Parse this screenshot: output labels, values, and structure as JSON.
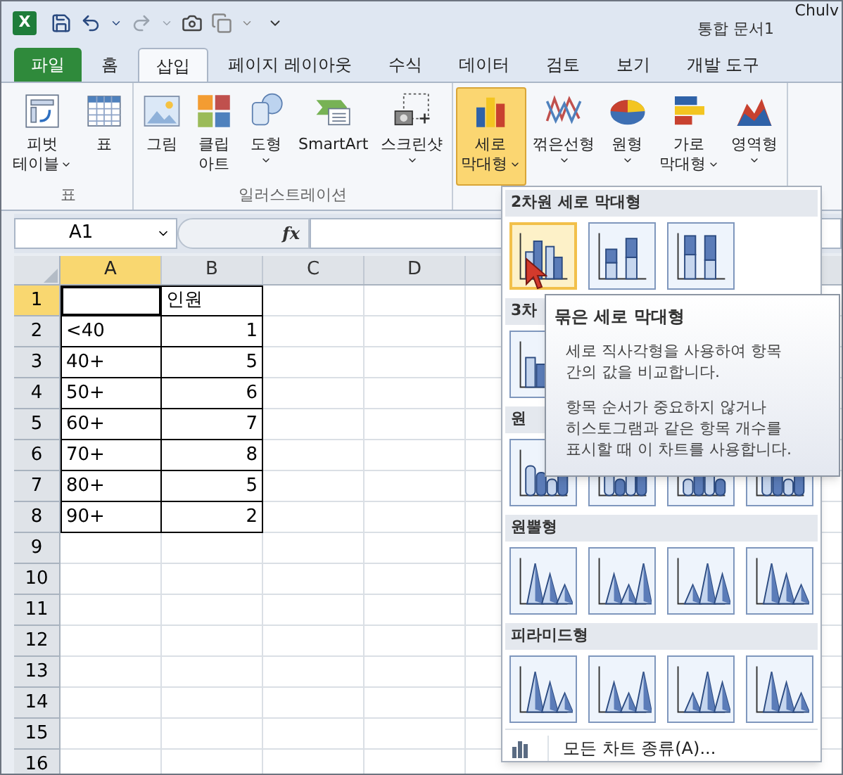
{
  "title_bar": {
    "logo": "X",
    "title": "통합 문서1",
    "overlay_text": "Chulv"
  },
  "ribbon_tabs": [
    {
      "label": "파일",
      "kind": "file",
      "selected": false
    },
    {
      "label": "홈",
      "kind": "tab",
      "selected": false
    },
    {
      "label": "삽입",
      "kind": "tab",
      "selected": true
    },
    {
      "label": "페이지 레이아웃",
      "kind": "tab",
      "selected": false
    },
    {
      "label": "수식",
      "kind": "tab",
      "selected": false
    },
    {
      "label": "데이터",
      "kind": "tab",
      "selected": false
    },
    {
      "label": "검토",
      "kind": "tab",
      "selected": false
    },
    {
      "label": "보기",
      "kind": "tab",
      "selected": false
    },
    {
      "label": "개발 도구",
      "kind": "tab",
      "selected": false
    }
  ],
  "ribbon_groups": [
    {
      "label": "표",
      "buttons": [
        {
          "lines": [
            "피벗",
            "테이블"
          ],
          "dropdown": true,
          "selected": false
        },
        {
          "lines": [
            "표"
          ],
          "dropdown": false,
          "selected": false
        }
      ]
    },
    {
      "label": "일러스트레이션",
      "buttons": [
        {
          "lines": [
            "그림"
          ],
          "dropdown": false,
          "selected": false
        },
        {
          "lines": [
            "클립",
            "아트"
          ],
          "dropdown": false,
          "selected": false
        },
        {
          "lines": [
            "도형"
          ],
          "dropdown": true,
          "selected": false
        },
        {
          "lines": [
            "SmartArt"
          ],
          "dropdown": false,
          "selected": false
        },
        {
          "lines": [
            "스크린샷"
          ],
          "dropdown": true,
          "selected": false
        }
      ]
    },
    {
      "buttons": [
        {
          "lines": [
            "세로",
            "막대형"
          ],
          "dropdown": true,
          "selected": true
        },
        {
          "lines": [
            "꺾은선형"
          ],
          "dropdown": true,
          "selected": false
        },
        {
          "lines": [
            "원형"
          ],
          "dropdown": true,
          "selected": false
        },
        {
          "lines": [
            "가로",
            "막대형"
          ],
          "dropdown": true,
          "selected": false
        },
        {
          "lines": [
            "영역형"
          ],
          "dropdown": true,
          "selected": false
        }
      ]
    }
  ],
  "formula_bar": {
    "name_box": "A1",
    "function_label": "fx"
  },
  "sheet": {
    "columns": [
      {
        "label": "A",
        "selected": true
      },
      {
        "label": "B",
        "selected": false
      },
      {
        "label": "C",
        "selected": false
      },
      {
        "label": "D",
        "selected": false
      }
    ],
    "rows": [
      {
        "label": "1",
        "selected": true,
        "cells": [
          {
            "kind": "empty"
          },
          {
            "kind": "text",
            "text": "인원"
          }
        ]
      },
      {
        "label": "2",
        "selected": false,
        "cells": [
          {
            "kind": "text",
            "text": "<40"
          },
          {
            "kind": "number",
            "text": "1"
          }
        ]
      },
      {
        "label": "3",
        "selected": false,
        "cells": [
          {
            "kind": "text",
            "text": "40+"
          },
          {
            "kind": "number",
            "text": "5"
          }
        ]
      },
      {
        "label": "4",
        "selected": false,
        "cells": [
          {
            "kind": "text",
            "text": "50+"
          },
          {
            "kind": "number",
            "text": "6"
          }
        ]
      },
      {
        "label": "5",
        "selected": false,
        "cells": [
          {
            "kind": "text",
            "text": "60+"
          },
          {
            "kind": "number",
            "text": "7"
          }
        ]
      },
      {
        "label": "6",
        "selected": false,
        "cells": [
          {
            "kind": "text",
            "text": "70+"
          },
          {
            "kind": "number",
            "text": "8"
          }
        ]
      },
      {
        "label": "7",
        "selected": false,
        "cells": [
          {
            "kind": "text",
            "text": "80+"
          },
          {
            "kind": "number",
            "text": "5"
          }
        ]
      },
      {
        "label": "8",
        "selected": false,
        "cells": [
          {
            "kind": "text",
            "text": "90+"
          },
          {
            "kind": "number",
            "text": "2"
          }
        ]
      },
      {
        "label": "9",
        "selected": false
      },
      {
        "label": "10",
        "selected": false
      },
      {
        "label": "11",
        "selected": false
      },
      {
        "label": "12",
        "selected": false
      },
      {
        "label": "13",
        "selected": false
      },
      {
        "label": "14",
        "selected": false
      },
      {
        "label": "15",
        "selected": false
      },
      {
        "label": "16",
        "selected": false
      }
    ]
  },
  "chart_menu": {
    "sections": [
      {
        "title": "2차원 세로 막대형",
        "items": [
          {
            "selected": true
          },
          {
            "selected": false
          },
          {
            "selected": false
          }
        ]
      },
      {
        "title": "3차",
        "items": [
          {
            "selected": false
          }
        ]
      },
      {
        "title": "원",
        "items": [
          {
            "selected": false
          },
          {
            "selected": false
          },
          {
            "selected": false
          },
          {
            "selected": false
          }
        ]
      },
      {
        "title": "원뿔형",
        "items": [
          {
            "selected": false
          },
          {
            "selected": false
          },
          {
            "selected": false
          },
          {
            "selected": false
          }
        ]
      },
      {
        "title": "피라미드형",
        "items": [
          {
            "selected": false
          },
          {
            "selected": false
          },
          {
            "selected": false
          },
          {
            "selected": false
          }
        ]
      }
    ],
    "footer": "모든 차트 종류(A)..."
  },
  "tooltip": {
    "title": "묶은 세로 막대형",
    "paragraphs": [
      [
        "세로 직사각형을 사용하여 항목",
        "간의 값을 비교합니다."
      ],
      [
        "항목 순서가 중요하지 않거나",
        "히스토그램과 같은 항목 개수를",
        "표시할 때 이 차트를 사용합니다."
      ]
    ]
  }
}
